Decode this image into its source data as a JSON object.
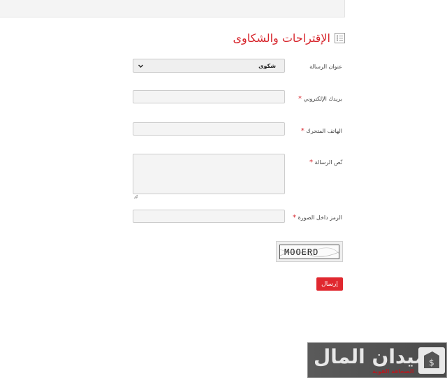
{
  "page": {
    "heading": "الإقتراحات والشكاوى",
    "heading_icon": "list-icon",
    "accent_color": "#d7262d"
  },
  "form": {
    "subject": {
      "label": "عنوان الرسالة",
      "selected": "شكوى"
    },
    "email": {
      "label": "بريدك الإلكتروني",
      "value": "",
      "required": true
    },
    "phone": {
      "label": "الهاتف المتحرك",
      "value": "",
      "required": true
    },
    "message": {
      "label": "نّص الرسالة",
      "value": "",
      "required": true
    },
    "captcha_code": {
      "label": "الرمز داخل الصورة",
      "value": "",
      "required": true
    },
    "required_mark": "*",
    "captcha_image_text": "MOOERD",
    "submit_label": "إرسال"
  },
  "watermark": {
    "name": "ميدان المال",
    "subtitle": "الصحافة القوية"
  }
}
